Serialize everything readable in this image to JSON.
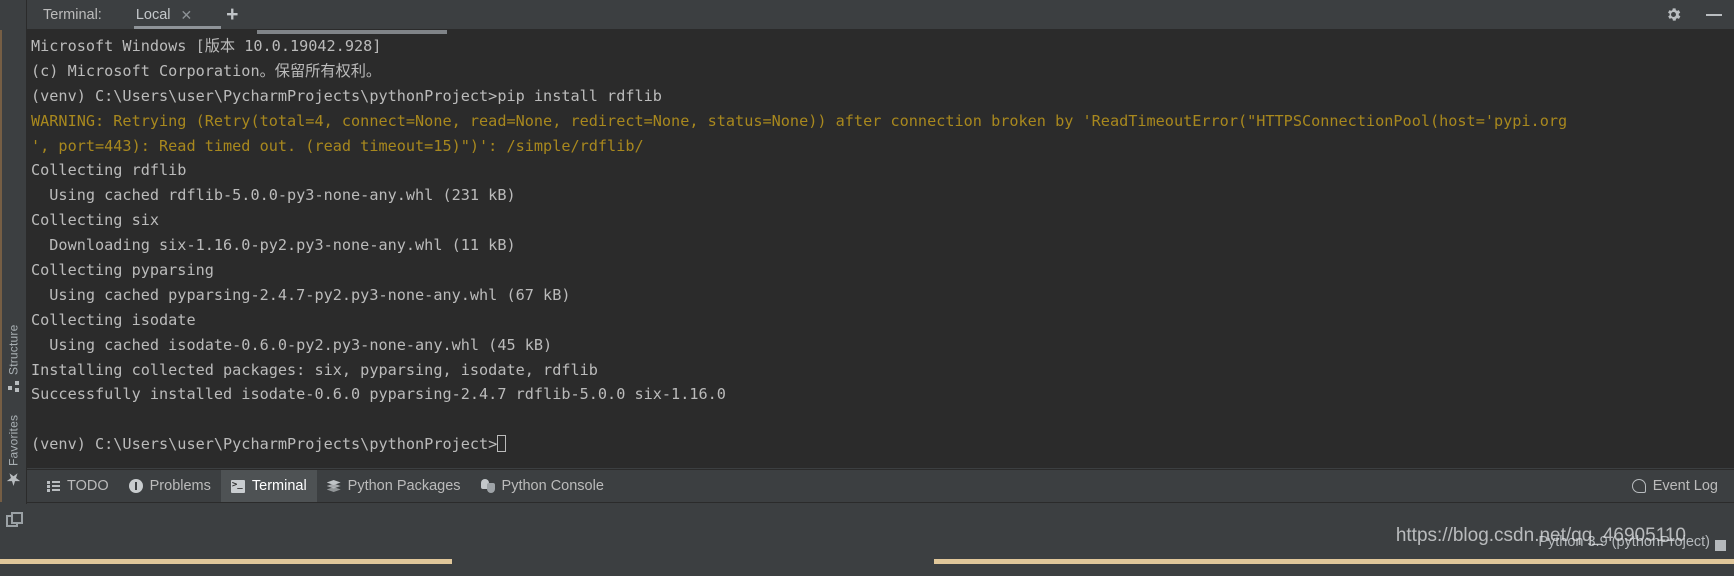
{
  "window": {
    "terminal_label": "Terminal:",
    "tab_label": "Local",
    "close_icon": "close-icon",
    "add_icon": "plus-icon",
    "settings_icon": "gear-icon",
    "minimize_icon": "minimize-icon"
  },
  "sidebar": {
    "items": [
      {
        "label": "Structure",
        "icon": "structure-icon"
      },
      {
        "label": "Favorites",
        "icon": "star-icon"
      }
    ]
  },
  "terminal": {
    "prompt_cursor": "block-cursor",
    "lines": [
      {
        "text": "Microsoft Windows [版本 10.0.19042.928]",
        "style": "normal"
      },
      {
        "text": "(c) Microsoft Corporation。保留所有权利。",
        "style": "normal"
      },
      {
        "text": "(venv) C:\\Users\\user\\PycharmProjects\\pythonProject>pip install rdflib",
        "style": "normal"
      },
      {
        "text": "WARNING: Retrying (Retry(total=4, connect=None, read=None, redirect=None, status=None)) after connection broken by 'ReadTimeoutError(\"HTTPSConnectionPool(host='pypi.org",
        "style": "warning"
      },
      {
        "text": "', port=443): Read timed out. (read timeout=15)\")': /simple/rdflib/",
        "style": "warning"
      },
      {
        "text": "Collecting rdflib",
        "style": "normal"
      },
      {
        "text": "  Using cached rdflib-5.0.0-py3-none-any.whl (231 kB)",
        "style": "normal"
      },
      {
        "text": "Collecting six",
        "style": "normal"
      },
      {
        "text": "  Downloading six-1.16.0-py2.py3-none-any.whl (11 kB)",
        "style": "normal"
      },
      {
        "text": "Collecting pyparsing",
        "style": "normal"
      },
      {
        "text": "  Using cached pyparsing-2.4.7-py2.py3-none-any.whl (67 kB)",
        "style": "normal"
      },
      {
        "text": "Collecting isodate",
        "style": "normal"
      },
      {
        "text": "  Using cached isodate-0.6.0-py2.py3-none-any.whl (45 kB)",
        "style": "normal"
      },
      {
        "text": "Installing collected packages: six, pyparsing, isodate, rdflib",
        "style": "normal"
      },
      {
        "text": "Successfully installed isodate-0.6.0 pyparsing-2.4.7 rdflib-5.0.0 six-1.16.0",
        "style": "normal"
      },
      {
        "text": "",
        "style": "normal"
      },
      {
        "text": "(venv) C:\\Users\\user\\PycharmProjects\\pythonProject>",
        "style": "prompt"
      }
    ]
  },
  "tool_window_bar": {
    "buttons": [
      {
        "label": "TODO",
        "icon": "todo-icon",
        "active": false
      },
      {
        "label": "Problems",
        "icon": "problems-icon",
        "active": false
      },
      {
        "label": "Terminal",
        "icon": "terminal-icon",
        "active": true
      },
      {
        "label": "Python Packages",
        "icon": "packages-icon",
        "active": false
      },
      {
        "label": "Python Console",
        "icon": "python-console-icon",
        "active": false
      }
    ],
    "event_log": {
      "label": "Event Log",
      "icon": "event-log-icon"
    }
  },
  "status_bar": {
    "interpreter": "Python 3.9 (pythonProject)",
    "watermark": "https://blog.csdn.net/qq_46905110"
  },
  "colors": {
    "ide_chrome": "#3c3f41",
    "terminal_bg": "#2b2b2b",
    "terminal_fg": "#bbbbbb",
    "warning_fg": "#a8881e",
    "active_tab_bg": "#4e5254",
    "accent_tan": "#e0c79a"
  }
}
